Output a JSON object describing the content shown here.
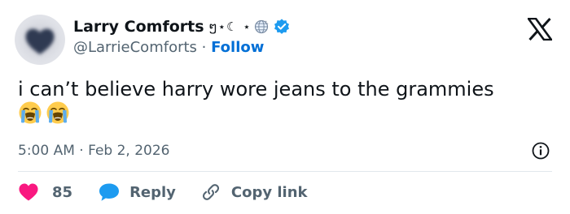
{
  "author": {
    "display_name": "Larry Comforts",
    "name_decoration": "ໆ⋆☾ ⋆",
    "handle": "@LarrieComforts",
    "separator": "·",
    "follow_label": "Follow",
    "verified": true
  },
  "tweet": {
    "text": "i can’t believe harry wore jeans to the grammies",
    "emojis": [
      "loudly-crying-face",
      "loudly-crying-face"
    ]
  },
  "meta": {
    "time": "5:00 AM",
    "separator": "·",
    "date": "Feb 2, 2026"
  },
  "actions": {
    "like_count": "85",
    "reply_label": "Reply",
    "copy_link_label": "Copy link"
  },
  "colors": {
    "accent": "#006fd6",
    "verified": "#1d9bf0",
    "like": "#f91880",
    "reply": "#1d9bf0",
    "muted_text": "#536471",
    "main_text": "#0f1419"
  },
  "icons": {
    "logo": "x-logo-icon",
    "verified": "verified-badge-icon",
    "globe": "globe-icon",
    "info": "info-icon",
    "like": "heart-icon",
    "reply": "speech-bubble-icon",
    "copy": "link-icon"
  }
}
